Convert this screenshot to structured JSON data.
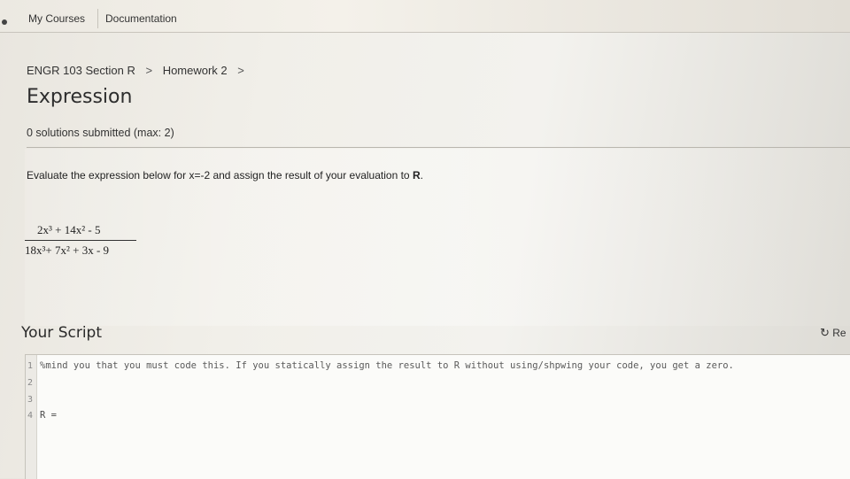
{
  "nav": {
    "my_courses": "My Courses",
    "documentation": "Documentation"
  },
  "breadcrumb": {
    "course": "ENGR 103 Section R",
    "assignment": "Homework 2",
    "sep": ">"
  },
  "problem": {
    "title": "Expression",
    "submissions": "0 solutions submitted (max: 2)",
    "instruction_prefix": "Evaluate the expression below for x=-2 and assign the result of your evaluation to ",
    "instruction_var": "R",
    "instruction_suffix": ".",
    "numerator": "2x³ + 14x² - 5",
    "denominator": "18x³+ 7x² + 3x - 9"
  },
  "script": {
    "heading": "Your Script",
    "reset_label": "Re",
    "reset_icon": "refresh-icon",
    "lines": [
      {
        "n": "1",
        "text": "%mind you that you must code this. If you statically assign the result to R without using/shpwing your code, you get a zero."
      },
      {
        "n": "2",
        "text": ""
      },
      {
        "n": "3",
        "text": ""
      },
      {
        "n": "4",
        "text": "R ="
      }
    ]
  }
}
